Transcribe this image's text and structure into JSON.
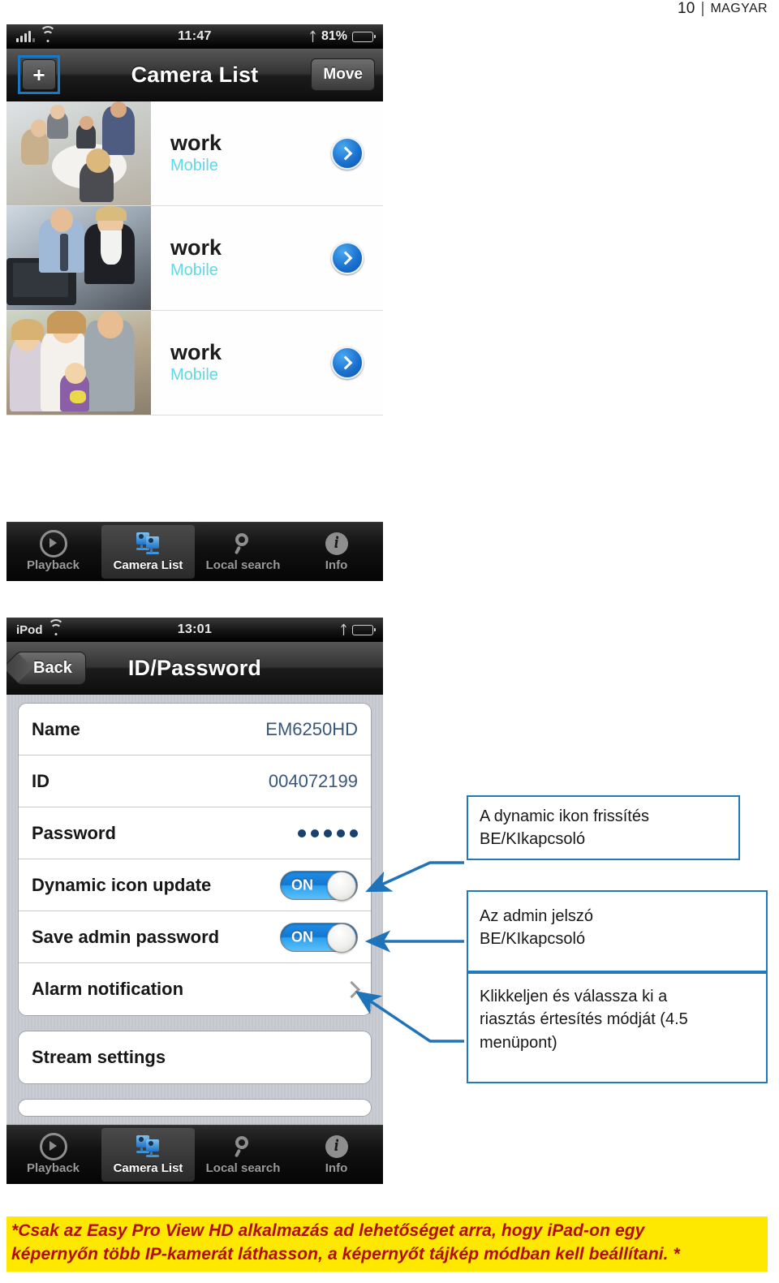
{
  "page_header": {
    "number": "10",
    "separator": "|",
    "language": "MAGYAR"
  },
  "screenshot_camera_list": {
    "status_bar": {
      "time": "11:47",
      "battery_percent": "81%",
      "icons": [
        "signal-bars-icon",
        "wifi-icon",
        "bluetooth-icon",
        "battery-icon"
      ]
    },
    "nav_bar": {
      "add_label": "+",
      "title": "Camera List",
      "move_label": "Move"
    },
    "rows": [
      {
        "title": "work",
        "subtitle": "Mobile",
        "thumb": "meeting-photo",
        "disclosure": "chevron-right-icon"
      },
      {
        "title": "work",
        "subtitle": "Mobile",
        "thumb": "office-photo",
        "disclosure": "chevron-right-icon"
      },
      {
        "title": "work",
        "subtitle": "Mobile",
        "thumb": "family-photo",
        "disclosure": "chevron-right-icon"
      }
    ],
    "tabs": [
      {
        "label": "Playback",
        "icon": "playback-icon",
        "active": false
      },
      {
        "label": "Camera List",
        "icon": "cameras-icon",
        "active": true
      },
      {
        "label": "Local search",
        "icon": "search-icon",
        "active": false
      },
      {
        "label": "Info",
        "icon": "info-icon",
        "active": false
      }
    ]
  },
  "screenshot_id_password": {
    "status_bar": {
      "carrier": "iPod",
      "time": "13:01",
      "icons": [
        "wifi-icon",
        "bluetooth-icon",
        "battery-icon"
      ]
    },
    "nav_bar": {
      "back_label": "Back",
      "title": "ID/Password"
    },
    "form_group_one": [
      {
        "label": "Name",
        "value": "EM6250HD",
        "type": "text"
      },
      {
        "label": "ID",
        "value": "004072199",
        "type": "text"
      },
      {
        "label": "Password",
        "value": "•••••",
        "dots": 5,
        "type": "password"
      },
      {
        "label": "Dynamic icon update",
        "value": "ON",
        "type": "toggle"
      },
      {
        "label": "Save admin password",
        "value": "ON",
        "type": "toggle"
      },
      {
        "label": "Alarm notification",
        "value": "",
        "type": "disclosure"
      }
    ],
    "form_group_two": [
      {
        "label": "Stream settings",
        "type": "plain"
      }
    ],
    "tabs": [
      {
        "label": "Playback",
        "icon": "playback-icon",
        "active": false
      },
      {
        "label": "Camera List",
        "icon": "cameras-icon",
        "active": true
      },
      {
        "label": "Local search",
        "icon": "search-icon",
        "active": false
      },
      {
        "label": "Info",
        "icon": "info-icon",
        "active": false
      }
    ]
  },
  "annotations": [
    {
      "line1": "A dynamic ikon frissítés",
      "line2": "BE/KIkapcsoló"
    },
    {
      "line1": "Az admin jelszó",
      "line2": "BE/KIkapcsoló"
    },
    {
      "line1": "Klikkeljen és válassza ki a",
      "line2": "riasztás értesítés módját (4.5",
      "line3": "menüpont)"
    }
  ],
  "footer": {
    "line1": "*Csak az Easy Pro View HD alkalmazás ad lehetőséget arra, hogy iPad-on  egy",
    "line2": "képernyőn több IP-kamerát láthasson, a képernyőt  tájkép módban kell beállítani. *"
  },
  "colors": {
    "accent_blue": "#2079bd",
    "toggle_on": "#1f8fe8",
    "subtitle_cyan": "#5fd9e6",
    "value_blue": "#38577e",
    "highlight_yellow": "#ffe800",
    "footer_red": "#b30c0c"
  }
}
